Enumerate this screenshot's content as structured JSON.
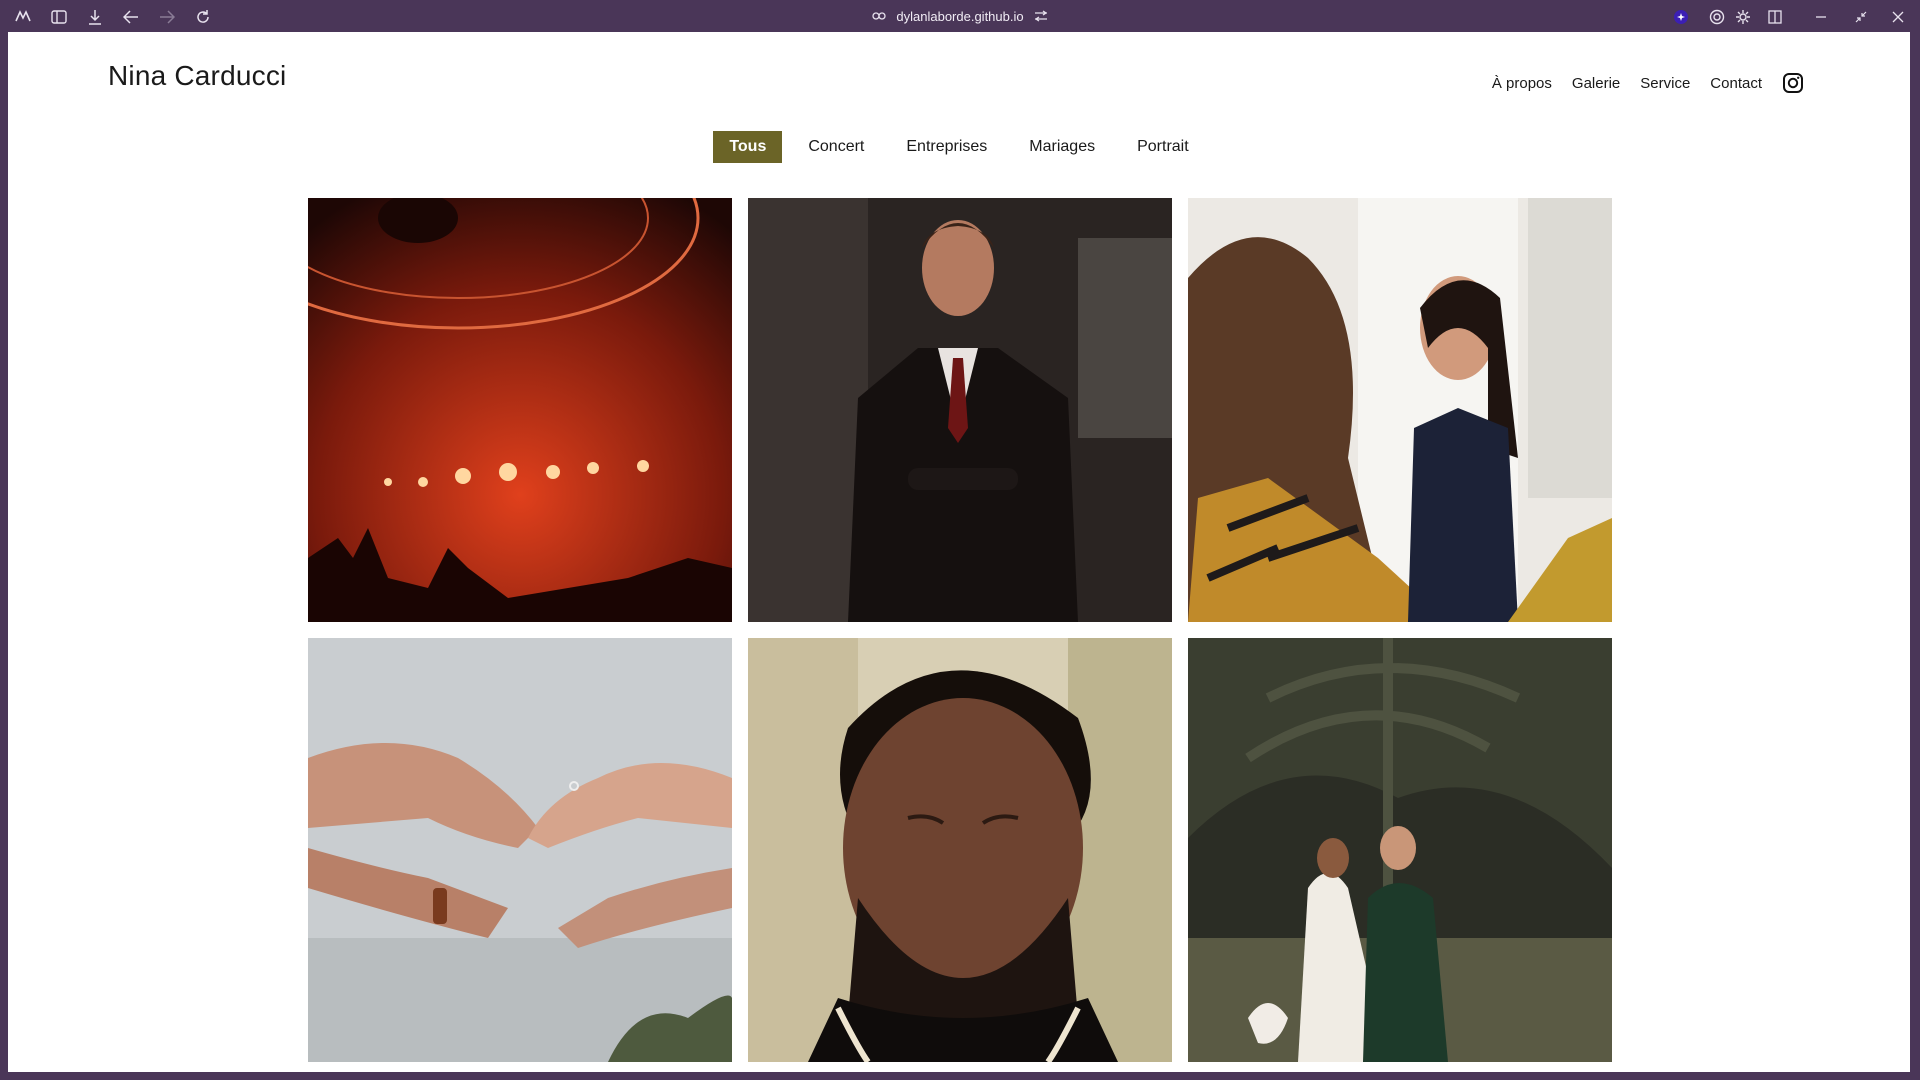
{
  "browser": {
    "url": "dylanlaborde.github.io"
  },
  "site": {
    "brand": "Nina Carducci",
    "nav": [
      "À propos",
      "Galerie",
      "Service",
      "Contact"
    ]
  },
  "filters": {
    "items": [
      "Tous",
      "Concert",
      "Entreprises",
      "Mariages",
      "Portrait"
    ],
    "active": "Tous"
  },
  "gallery": {
    "items": [
      {
        "category": "Concert",
        "icon": "concert-stage-photo"
      },
      {
        "category": "Entreprises",
        "icon": "businessman-portrait-photo"
      },
      {
        "category": "Entreprises",
        "icon": "office-meeting-photo"
      },
      {
        "category": "Mariages",
        "icon": "hands-ring-photo"
      },
      {
        "category": "Portrait",
        "icon": "man-portrait-photo"
      },
      {
        "category": "Mariages",
        "icon": "wedding-couple-photo"
      }
    ]
  },
  "colors": {
    "accent": "#6b6427",
    "chrome": "#4a3658"
  }
}
